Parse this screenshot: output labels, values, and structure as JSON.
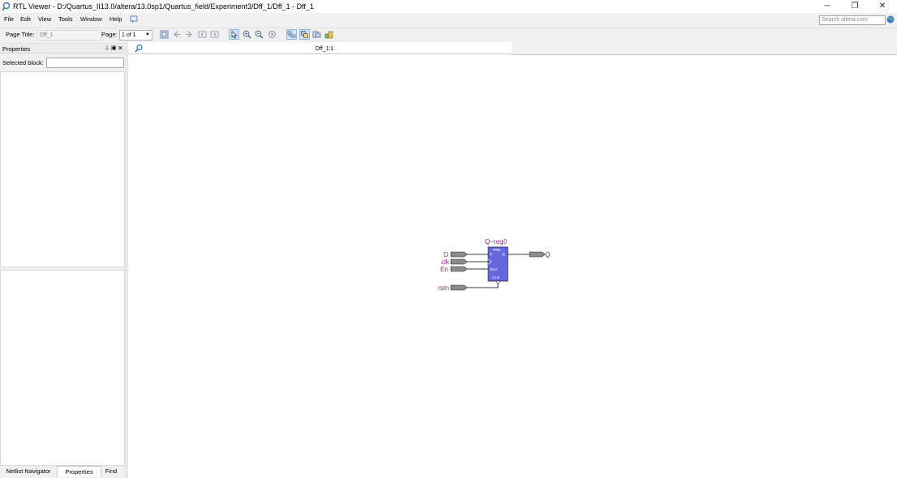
{
  "window": {
    "title": "RTL Viewer - D:/Quartus_II13.0/altera/13.0sp1/Quartus_field/Experiment3/Dff_1/Dff_1 - Dff_1",
    "minimize": "─",
    "restore": "❐",
    "close": "✕"
  },
  "menu": {
    "items": [
      "File",
      "Edit",
      "View",
      "Tools",
      "Window",
      "Help"
    ],
    "search_placeholder": "Search altera.com"
  },
  "toolbar": {
    "page_title_label": "Page Title:",
    "page_title_value": "Dff_1",
    "page_label": "Page:",
    "page_value": "1 of 1"
  },
  "properties": {
    "title": "Properties",
    "selected_block_label": "Selected block:",
    "selected_block_value": ""
  },
  "bottom_tabs": [
    "Netlist Navigator",
    "Properties",
    "Find"
  ],
  "document": {
    "tab_label": "Dff_1:1"
  },
  "schematic": {
    "register_name": "Q~reg0",
    "inputs": [
      "D",
      "clk",
      "En"
    ],
    "reset": "rstn",
    "output": "Q",
    "pin_D": "D",
    "pin_Q": "Q",
    "pin_ENA": "ENA",
    "pin_CLR": "CLR",
    "pin_PRE": "PRE",
    "colors": {
      "signal_label": "#a0208c",
      "register_fill": "#6666dd",
      "pin_fill": "#8c8c8c",
      "wire": "#000000"
    }
  }
}
